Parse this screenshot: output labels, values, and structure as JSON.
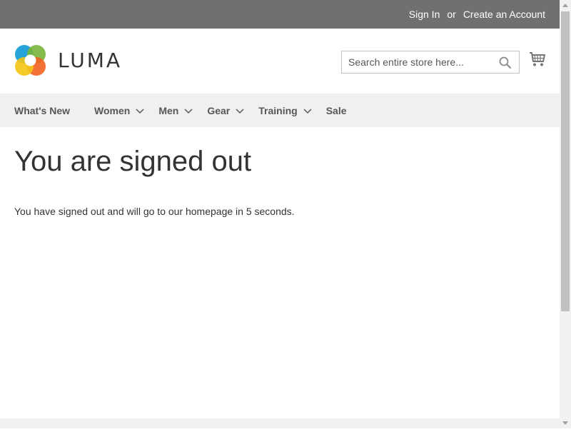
{
  "top_panel": {
    "sign_in": "Sign In",
    "separator": "or",
    "create_account": "Create an Account",
    "background_color": "#6e716e"
  },
  "header": {
    "logo_text": "LUMA",
    "logo_icon": "luma-logo-icon",
    "search": {
      "placeholder": "Search entire store here...",
      "value": "",
      "icon": "search-icon"
    },
    "cart_icon": "cart-icon"
  },
  "nav": {
    "items": [
      {
        "label": "What's New",
        "has_dropdown": false
      },
      {
        "label": "Women",
        "has_dropdown": true
      },
      {
        "label": "Men",
        "has_dropdown": true
      },
      {
        "label": "Gear",
        "has_dropdown": true
      },
      {
        "label": "Training",
        "has_dropdown": true
      },
      {
        "label": "Sale",
        "has_dropdown": false
      }
    ],
    "background_color": "#f0f0f0"
  },
  "main": {
    "title": "You are signed out",
    "message": "You have signed out and will go to our homepage in 5 seconds."
  }
}
